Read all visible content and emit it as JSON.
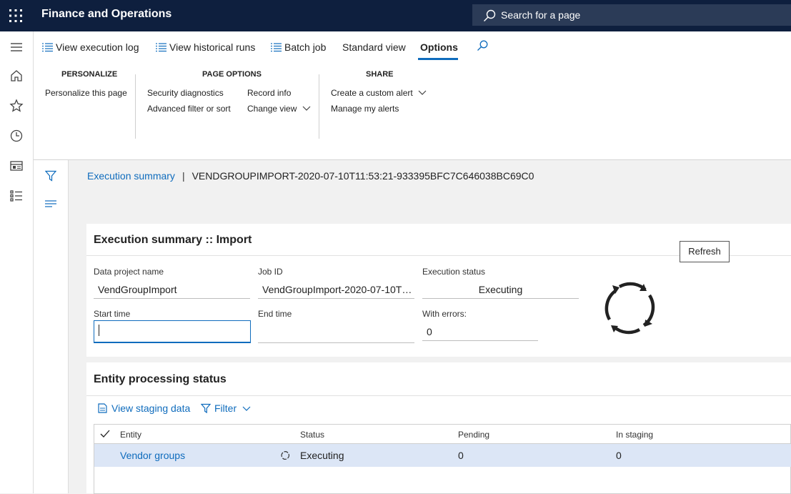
{
  "app": {
    "title": "Finance and Operations",
    "search_placeholder": "Search for a page"
  },
  "nav": [
    "hamburger-icon",
    "home-icon",
    "star-icon",
    "clock-icon",
    "workspace-icon",
    "modules-icon"
  ],
  "actionbar": {
    "items": [
      "View execution log",
      "View historical runs",
      "Batch job",
      "Standard view",
      "Options"
    ],
    "active": "Options"
  },
  "ribbon": {
    "personalize": {
      "heading": "PERSONALIZE",
      "items": [
        "Personalize this page"
      ]
    },
    "page_options": {
      "heading": "PAGE OPTIONS",
      "items": [
        "Security diagnostics",
        "Advanced filter or sort",
        "Record info",
        "Change view"
      ]
    },
    "share": {
      "heading": "SHARE",
      "items": [
        "Create a custom alert",
        "Manage my alerts"
      ]
    }
  },
  "breadcrumb": {
    "link": "Execution summary",
    "separator": "|",
    "current": "VENDGROUPIMPORT-2020-07-10T11:53:21-933395BFC7C646038BC69C0"
  },
  "summary": {
    "title": "Execution summary :: Import",
    "project_label": "Data project name",
    "project_value": "VendGroupImport",
    "job_label": "Job ID",
    "job_value": "VendGroupImport-2020-07-10T…",
    "status_label": "Execution status",
    "status_value": "Executing",
    "start_label": "Start time",
    "start_value": "",
    "end_label": "End time",
    "end_value": "",
    "errors_label": "With errors:",
    "errors_value": "0",
    "refresh_label": "Refresh"
  },
  "entity": {
    "title": "Entity processing status",
    "view_staging": "View staging data",
    "filter": "Filter",
    "columns": [
      "Entity",
      "Status",
      "Pending",
      "In staging"
    ],
    "rows": [
      {
        "entity": "Vendor groups",
        "status": "Executing",
        "pending": "0",
        "in_staging": "0"
      }
    ]
  },
  "colors": {
    "topbar": "#0e1f3e",
    "accent": "#0f6cbd",
    "selected_row": "#dce6f6"
  }
}
